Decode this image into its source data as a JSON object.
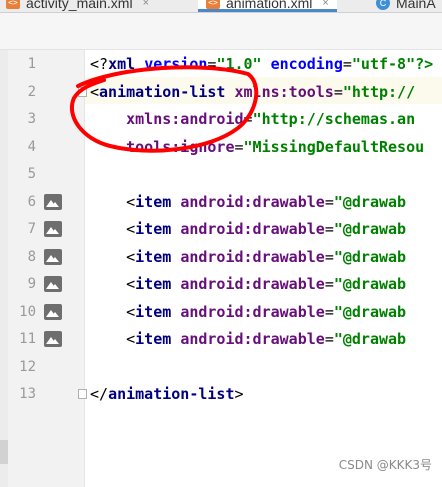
{
  "tabs": [
    {
      "label": "activity_main.xml",
      "icon": "xml-file-icon",
      "active": false
    },
    {
      "label": "animation.xml",
      "icon": "xml-file-icon",
      "active": true
    },
    {
      "label": "MainA",
      "icon": "class-c-icon",
      "active": false
    }
  ],
  "tab_close_glyph": "×",
  "xml_icon_glyph": "<>",
  "class_icon_glyph": "C",
  "line_numbers": [
    "1",
    "2",
    "3",
    "4",
    "5",
    "6",
    "7",
    "8",
    "9",
    "10",
    "11",
    "12",
    "13"
  ],
  "code_lines": [
    {
      "parts": [
        {
          "t": "punc",
          "v": "<?"
        },
        {
          "t": "tag",
          "v": "xml"
        },
        {
          "t": "punc",
          "v": " "
        },
        {
          "t": "attrname",
          "v": "version"
        },
        {
          "t": "punc",
          "v": "="
        },
        {
          "t": "str",
          "v": "\"1.0\""
        },
        {
          "t": "punc",
          "v": " "
        },
        {
          "t": "attrname",
          "v": "encoding"
        },
        {
          "t": "punc",
          "v": "="
        },
        {
          "t": "str",
          "v": "\"utf-8\"?>"
        }
      ]
    },
    {
      "parts": [
        {
          "t": "punc",
          "v": "<"
        },
        {
          "t": "tag",
          "v": "animation-list"
        },
        {
          "t": "punc",
          "v": " "
        },
        {
          "t": "attr",
          "v": "xmlns:tools"
        },
        {
          "t": "punc",
          "v": "="
        },
        {
          "t": "str",
          "v": "\"http://"
        }
      ]
    },
    {
      "parts": [
        {
          "t": "punc",
          "v": "    "
        },
        {
          "t": "attr",
          "v": "xmlns:android"
        },
        {
          "t": "punc",
          "v": "="
        },
        {
          "t": "str",
          "v": "\"http://schemas.an"
        }
      ]
    },
    {
      "parts": [
        {
          "t": "punc",
          "v": "    "
        },
        {
          "t": "attr",
          "v": "tools:ignore"
        },
        {
          "t": "punc",
          "v": "="
        },
        {
          "t": "str",
          "v": "\"MissingDefaultResou"
        }
      ]
    },
    {
      "parts": []
    },
    {
      "parts": [
        {
          "t": "punc",
          "v": "    <"
        },
        {
          "t": "tag",
          "v": "item"
        },
        {
          "t": "punc",
          "v": " "
        },
        {
          "t": "attr",
          "v": "android:drawable"
        },
        {
          "t": "punc",
          "v": "="
        },
        {
          "t": "str",
          "v": "\"@drawab"
        }
      ]
    },
    {
      "parts": [
        {
          "t": "punc",
          "v": "    <"
        },
        {
          "t": "tag",
          "v": "item"
        },
        {
          "t": "punc",
          "v": " "
        },
        {
          "t": "attr",
          "v": "android:drawable"
        },
        {
          "t": "punc",
          "v": "="
        },
        {
          "t": "str",
          "v": "\"@drawab"
        }
      ]
    },
    {
      "parts": [
        {
          "t": "punc",
          "v": "    <"
        },
        {
          "t": "tag",
          "v": "item"
        },
        {
          "t": "punc",
          "v": " "
        },
        {
          "t": "attr",
          "v": "android:drawable"
        },
        {
          "t": "punc",
          "v": "="
        },
        {
          "t": "str",
          "v": "\"@drawab"
        }
      ]
    },
    {
      "parts": [
        {
          "t": "punc",
          "v": "    <"
        },
        {
          "t": "tag",
          "v": "item"
        },
        {
          "t": "punc",
          "v": " "
        },
        {
          "t": "attr",
          "v": "android:drawable"
        },
        {
          "t": "punc",
          "v": "="
        },
        {
          "t": "str",
          "v": "\"@drawab"
        }
      ]
    },
    {
      "parts": [
        {
          "t": "punc",
          "v": "    <"
        },
        {
          "t": "tag",
          "v": "item"
        },
        {
          "t": "punc",
          "v": " "
        },
        {
          "t": "attr",
          "v": "android:drawable"
        },
        {
          "t": "punc",
          "v": "="
        },
        {
          "t": "str",
          "v": "\"@drawab"
        }
      ]
    },
    {
      "parts": [
        {
          "t": "punc",
          "v": "    <"
        },
        {
          "t": "tag",
          "v": "item"
        },
        {
          "t": "punc",
          "v": " "
        },
        {
          "t": "attr",
          "v": "android:drawable"
        },
        {
          "t": "punc",
          "v": "="
        },
        {
          "t": "str",
          "v": "\"@drawab"
        }
      ]
    },
    {
      "parts": []
    },
    {
      "parts": [
        {
          "t": "punc",
          "v": "</"
        },
        {
          "t": "tag",
          "v": "animation-list"
        },
        {
          "t": "punc",
          "v": ">"
        }
      ]
    }
  ],
  "image_gutter_lines": [
    "6",
    "7",
    "8",
    "9",
    "10",
    "11"
  ],
  "fold_lines": [
    "2",
    "13"
  ],
  "annotation_color": "#ff0000",
  "watermark": "CSDN @KKK3号"
}
